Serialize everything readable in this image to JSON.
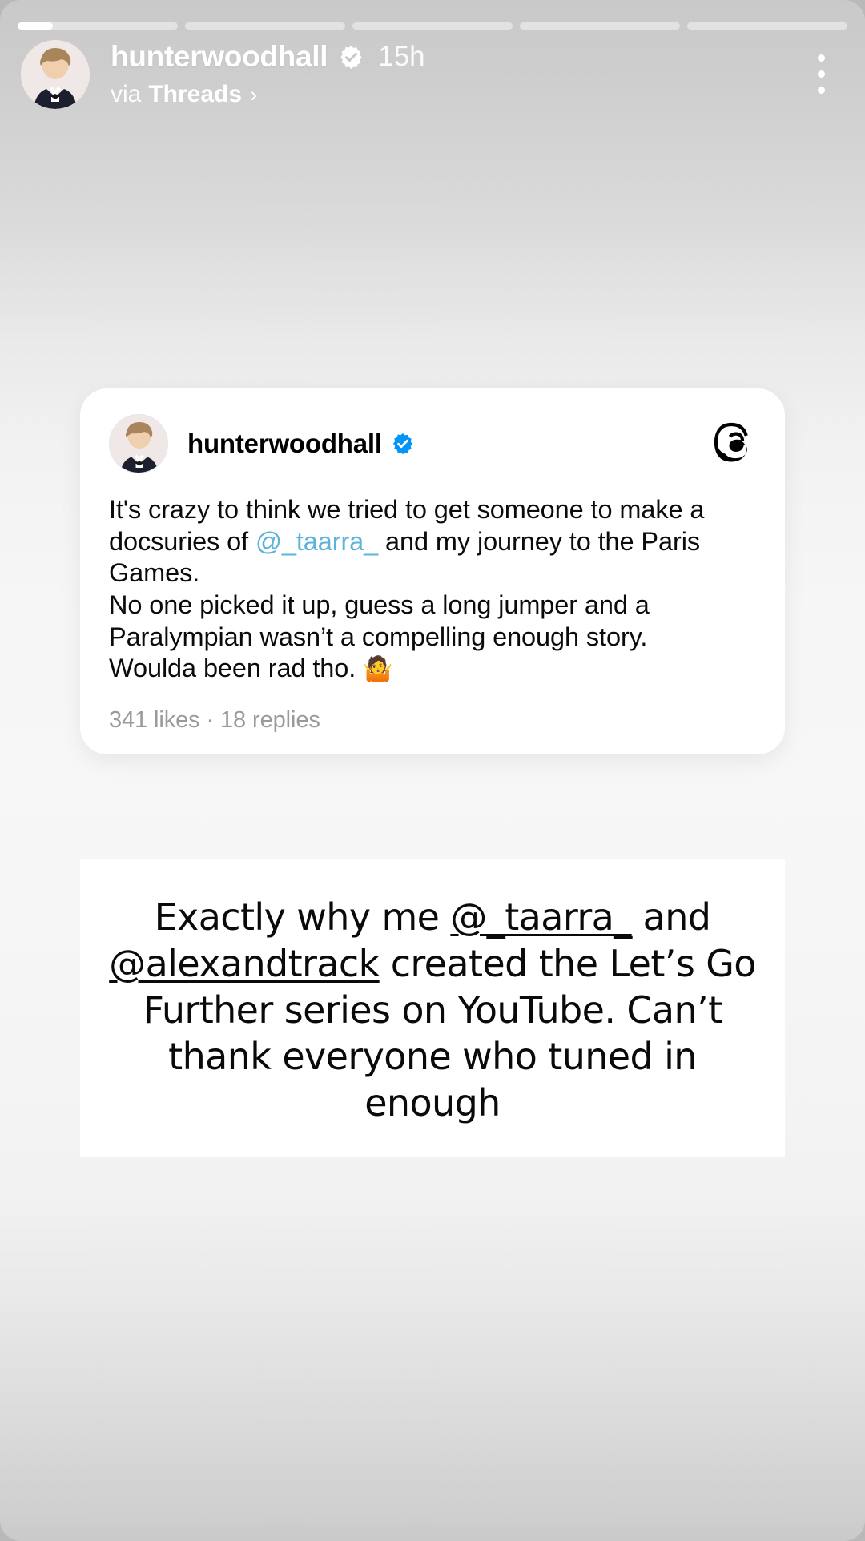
{
  "story": {
    "progress": {
      "segment_count": 5,
      "active_index": 0,
      "active_fill_percent": 22
    },
    "header": {
      "username": "hunterwoodhall",
      "verified_icon": "verified-badge-icon",
      "timestamp": "15h",
      "via_label": "via",
      "via_source": "Threads",
      "chevron": "›",
      "menu_icon": "kebab-menu-icon",
      "avatar_icon": "profile-avatar"
    }
  },
  "threads_card": {
    "avatar_icon": "profile-avatar",
    "username": "hunterwoodhall",
    "verified_icon": "verified-badge-icon",
    "platform_icon": "threads-logo-icon",
    "body": {
      "line1_a": "It's crazy to think we tried to get someone to make a docsuries of ",
      "mention": "@_taarra_",
      "line1_b": " and my journey to the Paris Games.",
      "line2": "No one picked it up, guess a long jumper and a Paralympian wasn’t a compelling enough story.",
      "line3": "Woulda been rad tho. ",
      "emoji": "🤷"
    },
    "meta": "341 likes · 18 replies",
    "likes_count": "341",
    "replies_count": "18"
  },
  "caption": {
    "part1": "Exactly why me ",
    "mention1": "@_taarra_",
    "part2": " and ",
    "mention2": "@alexandtrack",
    "part3": " created the Let’s Go Further series on YouTube. Can’t thank everyone who tuned in enough"
  },
  "colors": {
    "mention_blue": "#5db3d9",
    "verified_blue": "#0095f6",
    "card_white": "#ffffff",
    "meta_gray": "#9a9a9a"
  }
}
